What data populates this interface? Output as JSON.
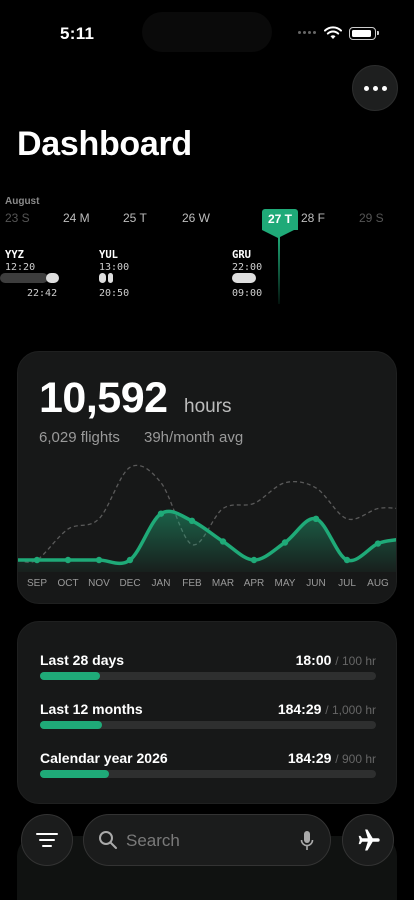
{
  "status": {
    "time": "5:11"
  },
  "page": {
    "title": "Dashboard"
  },
  "timeline": {
    "month": "August",
    "days": [
      {
        "label": "23 S",
        "style": "dim"
      },
      {
        "label": "24 M",
        "style": "mid"
      },
      {
        "label": "25 T",
        "style": "mid"
      },
      {
        "label": "26 W",
        "style": "mid"
      },
      {
        "label": "27 T",
        "style": "today"
      },
      {
        "label": "28 F",
        "style": "mid"
      },
      {
        "label": "29 S",
        "style": "dim"
      }
    ],
    "flights": [
      {
        "code": "YYZ",
        "dep": "12:20",
        "arr": "22:42"
      },
      {
        "code": "YUL",
        "dep": "13:00",
        "arr": "20:50"
      },
      {
        "code": "GRU",
        "dep": "22:00",
        "arr": "09:00"
      }
    ]
  },
  "hours_card": {
    "total": "10,592",
    "unit": "hours",
    "flights": "6,029 flights",
    "avg": "39h/month avg",
    "highlight_color": "#1faa78"
  },
  "chart_data": {
    "type": "area",
    "categories": [
      "SEP",
      "OCT",
      "NOV",
      "DEC",
      "JAN",
      "FEB",
      "MAR",
      "APR",
      "MAY",
      "JUN",
      "JUL",
      "AUG"
    ],
    "series": [
      {
        "values": [
          0,
          0,
          0,
          0,
          45,
          38,
          18,
          0,
          17,
          40,
          0,
          16
        ]
      },
      {
        "values": [
          0,
          30,
          40,
          90,
          75,
          15,
          50,
          55,
          75,
          70,
          40,
          50
        ]
      }
    ],
    "ylim": [
      0,
      100
    ]
  },
  "limits": [
    {
      "label": "Last 28 days",
      "value": "18:00",
      "limit": "/ 100 hr",
      "fraction": 0.18
    },
    {
      "label": "Last 12 months",
      "value": "184:29",
      "limit": "/ 1,000 hr",
      "fraction": 0.185
    },
    {
      "label": "Calendar year 2026",
      "value": "184:29",
      "limit": "/ 900 hr",
      "fraction": 0.205
    }
  ],
  "bottom_bar": {
    "search_placeholder": "Search",
    "icons": {
      "menu": "filter-lines-icon",
      "search": "magnifier-icon",
      "mic": "microphone-icon",
      "plane": "airplane-icon",
      "more": "ellipsis-icon"
    }
  }
}
